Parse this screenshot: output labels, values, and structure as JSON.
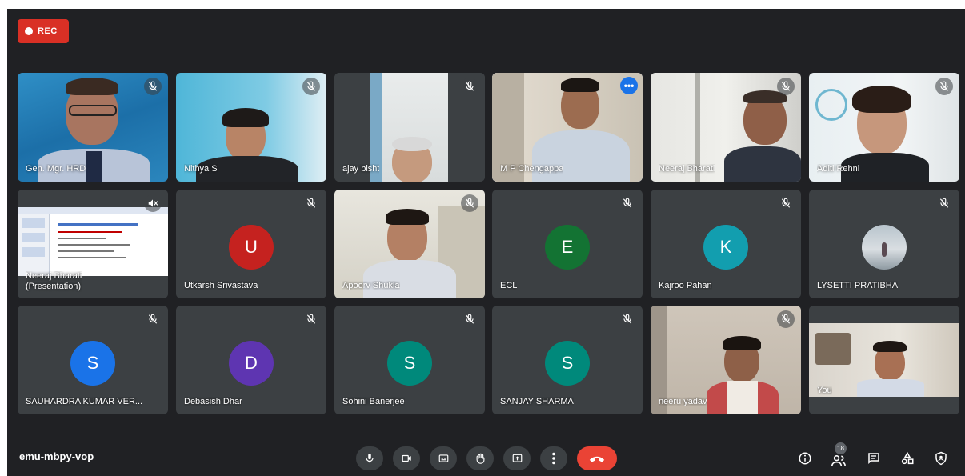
{
  "recording": {
    "label": "REC"
  },
  "participants": [
    {
      "name": "Gen. Mgr. HRD"
    },
    {
      "name": "Nithya S"
    },
    {
      "name": "ajay bisht"
    },
    {
      "name": "M P Chengappa"
    },
    {
      "name": "Neeraj Bharati"
    },
    {
      "name": "Aditi Rehni"
    },
    {
      "name": "Neeraj Bharati",
      "sub": "(Presentation)"
    },
    {
      "name": "Utkarsh Srivastava",
      "initial": "U",
      "color": "#c5221f"
    },
    {
      "name": "Apoorv Shukla"
    },
    {
      "name": "ECL",
      "initial": "E",
      "color": "#137333"
    },
    {
      "name": "Kajroo Pahan",
      "initial": "K",
      "color": "#129eaf"
    },
    {
      "name": "LYSETTI PRATIBHA"
    },
    {
      "name": "SAUHARDRA KUMAR VER...",
      "initial": "S",
      "color": "#1a73e8"
    },
    {
      "name": "Debasish Dhar",
      "initial": "D",
      "color": "#5e35b1"
    },
    {
      "name": "Sohini Banerjee",
      "initial": "S",
      "color": "#00897b"
    },
    {
      "name": "SANJAY SHARMA",
      "initial": "S",
      "color": "#00897b"
    },
    {
      "name": "neeru yadav"
    },
    {
      "name": "You"
    }
  ],
  "meeting": {
    "code": "emu-mbpy-vop",
    "participant_count": "18"
  },
  "colors": {
    "background": "#202124",
    "tile": "#3c4043",
    "accent": "#8ab4f8",
    "hangup": "#ea4335"
  },
  "icons": [
    "mic-off-icon",
    "more-options-icon",
    "mic-icon",
    "camera-icon",
    "captions-icon",
    "raise-hand-icon",
    "present-icon",
    "more-vert-icon",
    "hangup-icon",
    "info-icon",
    "people-icon",
    "chat-icon",
    "activities-icon",
    "host-controls-icon"
  ]
}
